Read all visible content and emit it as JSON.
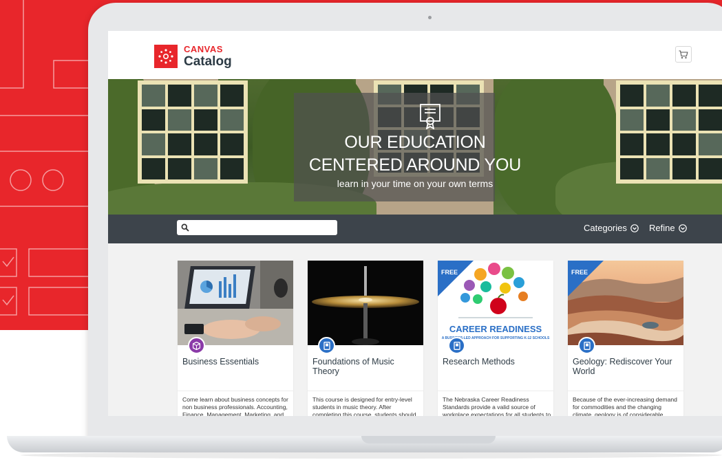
{
  "colors": {
    "brand_red": "#e8262b",
    "dark_text": "#2d3b45",
    "filter_bar": "#3d444b",
    "free_ribbon": "#2a6fc6"
  },
  "header": {
    "brand": "CANVAS",
    "product": "Catalog",
    "cart_icon": "shopping-cart-icon"
  },
  "hero": {
    "icon": "certificate-icon",
    "line1": "OUR EDUCATION",
    "line2": "CENTERED AROUND YOU",
    "subtitle": "learn in your time on your own terms"
  },
  "filter_bar": {
    "search_placeholder": "",
    "categories_label": "Categories",
    "refine_label": "Refine"
  },
  "courses": [
    {
      "title": "Business Essentials",
      "badge_icon": "module-icon",
      "badge_color": "#8b3aa8",
      "free": false,
      "free_label": "",
      "description": "Come learn about business concepts for non business professionals. Accounting, Finance, Management, Marketing, and"
    },
    {
      "title": "Foundations of Music Theory",
      "badge_icon": "course-icon",
      "badge_color": "#2a6fc6",
      "free": false,
      "free_label": "",
      "description": "This course is designed for entry-level students in music theory. After completing this course, students should have a strong"
    },
    {
      "title": "Research Methods",
      "badge_icon": "course-icon",
      "badge_color": "#2a6fc6",
      "free": true,
      "free_label": "FREE",
      "image_heading": "CAREER READINESS",
      "image_subheading": "A BUSINESS-LED APPROACH FOR SUPPORTING K-12 SCHOOLS",
      "description": "The Nebraska Career Readiness Standards provide a valid source of workplace expectations for all students to be career"
    },
    {
      "title": "Geology: Rediscover Your World",
      "badge_icon": "course-icon",
      "badge_color": "#2a6fc6",
      "free": true,
      "free_label": "FREE",
      "description": "Because of the ever-increasing demand for commodities and the changing climate, geology is of considerable societal"
    }
  ]
}
